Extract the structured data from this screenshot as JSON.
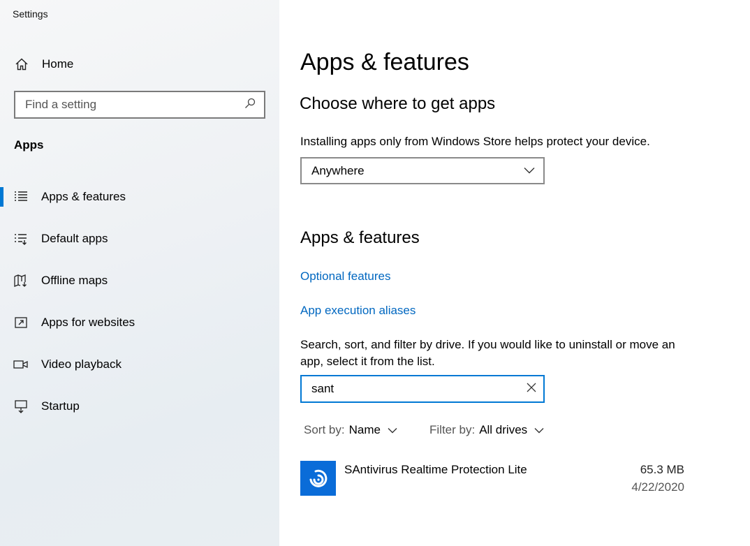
{
  "window": {
    "title": "Settings"
  },
  "sidebar": {
    "home_label": "Home",
    "search_placeholder": "Find a setting",
    "section_title": "Apps",
    "items": [
      {
        "label": "Apps & features",
        "icon": "apps-features-icon",
        "active": true
      },
      {
        "label": "Default apps",
        "icon": "default-apps-icon",
        "active": false
      },
      {
        "label": "Offline maps",
        "icon": "offline-maps-icon",
        "active": false
      },
      {
        "label": "Apps for websites",
        "icon": "apps-websites-icon",
        "active": false
      },
      {
        "label": "Video playback",
        "icon": "video-playback-icon",
        "active": false
      },
      {
        "label": "Startup",
        "icon": "startup-icon",
        "active": false
      }
    ]
  },
  "main": {
    "title": "Apps & features",
    "choose_heading": "Choose where to get apps",
    "choose_desc": "Installing apps only from Windows Store helps protect your device.",
    "source_dropdown": {
      "value": "Anywhere"
    },
    "apps_heading": "Apps & features",
    "links": {
      "optional_features": "Optional features",
      "execution_aliases": "App execution aliases"
    },
    "search_desc": "Search, sort, and filter by drive. If you would like to uninstall or move an app, select it from the list.",
    "search_value": "sant",
    "sort": {
      "label": "Sort by:",
      "value": "Name"
    },
    "filter": {
      "label": "Filter by:",
      "value": "All drives"
    },
    "apps": [
      {
        "name": "SAntivirus Realtime Protection Lite",
        "size": "65.3 MB",
        "date": "4/22/2020",
        "icon": "santivirus-app-icon"
      }
    ]
  },
  "colors": {
    "accent": "#0078d4",
    "link": "#0067c0",
    "app_icon_bg": "#0a6cd8"
  }
}
